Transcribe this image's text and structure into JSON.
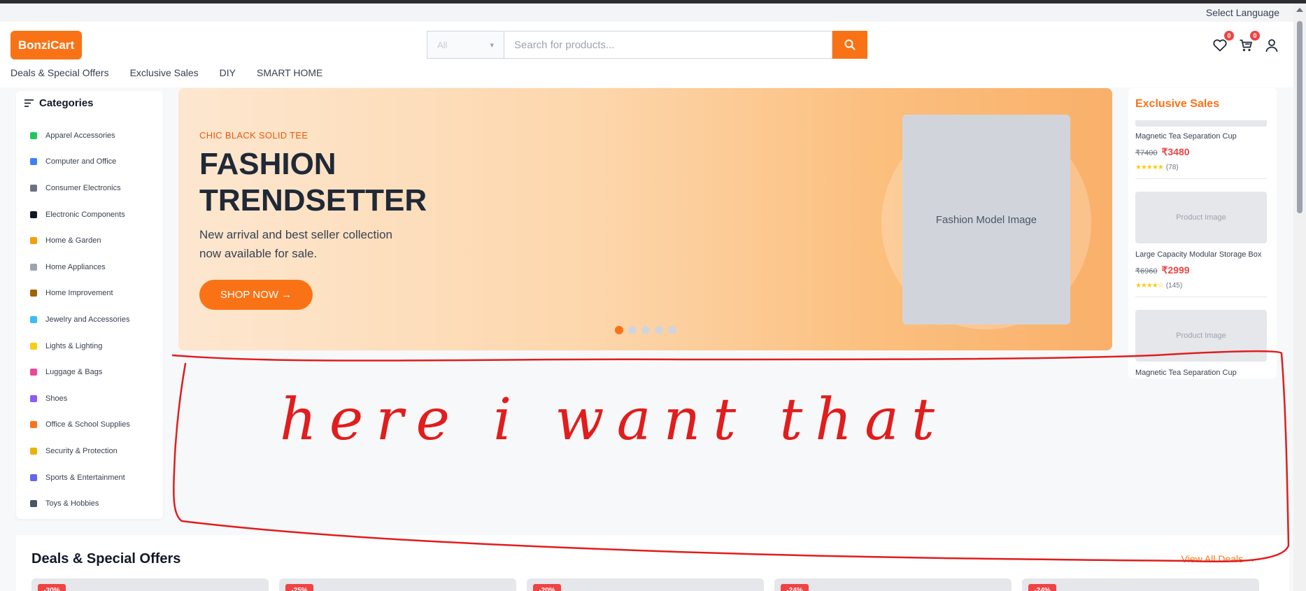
{
  "topbar": {
    "language_label": "Select Language"
  },
  "header": {
    "logo": "BonziCart",
    "search": {
      "category_value": "All",
      "placeholder": "Search for products..."
    },
    "wishlist_count": "0",
    "cart_count": "0"
  },
  "nav": {
    "items": [
      "Deals & Special Offers",
      "Exclusive Sales",
      "DIY",
      "SMART HOME"
    ]
  },
  "sidebar": {
    "title": "Categories",
    "items": [
      {
        "label": "Apparel Accessories",
        "icon": "shirt-icon",
        "color": "#22c55e"
      },
      {
        "label": "Computer and Office",
        "icon": "monitor-icon",
        "color": "#3b82f6"
      },
      {
        "label": "Consumer Electronics",
        "icon": "phone-icon",
        "color": "#6b7280"
      },
      {
        "label": "Electronic Components",
        "icon": "plug-icon",
        "color": "#111827"
      },
      {
        "label": "Home & Garden",
        "icon": "house-icon",
        "color": "#f59e0b"
      },
      {
        "label": "Home Appliances",
        "icon": "wrench-icon",
        "color": "#9ca3af"
      },
      {
        "label": "Home Improvement",
        "icon": "hammer-icon",
        "color": "#a16207"
      },
      {
        "label": "Jewelry and Accessories",
        "icon": "gem-icon",
        "color": "#38bdf8"
      },
      {
        "label": "Lights & Lighting",
        "icon": "bulb-icon",
        "color": "#facc15"
      },
      {
        "label": "Luggage & Bags",
        "icon": "bag-icon",
        "color": "#ec4899"
      },
      {
        "label": "Shoes",
        "icon": "shoe-icon",
        "color": "#8b5cf6"
      },
      {
        "label": "Office & School Supplies",
        "icon": "books-icon",
        "color": "#f97316"
      },
      {
        "label": "Security & Protection",
        "icon": "lock-icon",
        "color": "#eab308"
      },
      {
        "label": "Sports & Entertainment",
        "icon": "ball-icon",
        "color": "#6366f1"
      },
      {
        "label": "Toys & Hobbies",
        "icon": "gamepad-icon",
        "color": "#4b5563"
      }
    ]
  },
  "hero": {
    "kicker": "CHIC BLACK SOLID TEE",
    "headline": "FASHION TRENDSETTER",
    "subtitle": "New arrival and best seller collection now available for sale.",
    "cta": "SHOP NOW →",
    "image_placeholder": "Fashion Model Image",
    "slide_count": 5,
    "active_slide": 1
  },
  "exclusive": {
    "title": "Exclusive Sales",
    "items": [
      {
        "name": "Magnetic Tea Separation Cup",
        "old_price": "₹7400",
        "new_price": "₹3480",
        "stars": "★★★★★",
        "reviews": "(78)"
      },
      {
        "image": "Product Image",
        "name": "Large Capacity Modular Storage Box",
        "old_price": "₹6960",
        "new_price": "₹2999",
        "stars": "★★★★☆",
        "reviews": "(145)"
      },
      {
        "image": "Product Image",
        "name": "Magnetic Tea Separation Cup"
      }
    ]
  },
  "annotation": {
    "text": "here i want that",
    "color": "#e11d1d"
  },
  "deals": {
    "title": "Deals & Special Offers",
    "view_all": "View All Deals →",
    "tags": [
      "-30%",
      "-25%",
      "-20%",
      "-24%",
      "-24%"
    ]
  },
  "colors": {
    "accent": "#f97316",
    "price_red": "#ef4444"
  }
}
